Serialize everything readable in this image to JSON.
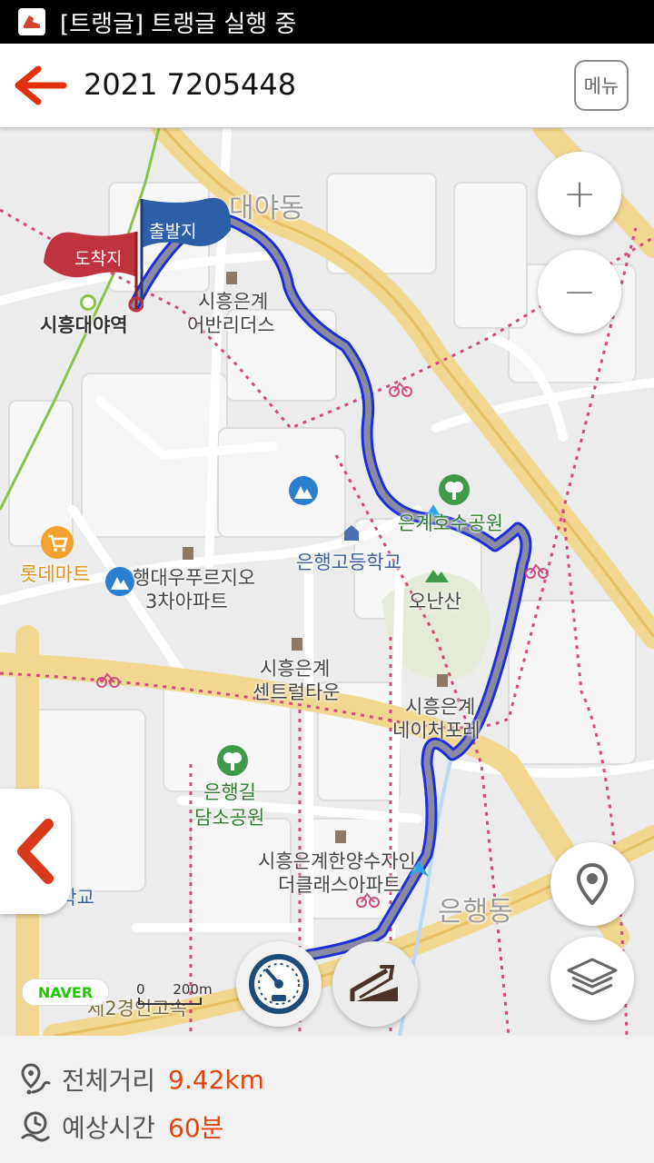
{
  "status_bar": {
    "app_icon": "trangle-shoe-icon",
    "text": "[트랭글] 트랭글 실행 중"
  },
  "header": {
    "title": "2021 7205448",
    "back_icon": "arrow-left-icon",
    "menu_label": "메뉴"
  },
  "map": {
    "flags": {
      "start": "출발지",
      "end": "도착지"
    },
    "labels": {
      "daeya_dong": "대야동",
      "station": "시흥대야역",
      "eunsan_1": "시흥은계",
      "eunsan_2": "어반리더스",
      "lake_park": "은계호수공원",
      "high_school": "은행고등학교",
      "lotte_mart": "롯데마트",
      "apt_1": "행대우푸르지오",
      "apt_2": "3차아파트",
      "onansan": "오난산",
      "central_1": "시흥은계",
      "central_2": "센트럴타운",
      "naepo_1": "시흥은계",
      "naepo_2": "네이처포레",
      "damso_1": "은행길",
      "damso_2": "담소공원",
      "hanyang_1": "시흥은계한양수자인",
      "hanyang_2": "더클래스아파트",
      "school_partial": "등학교",
      "eunhaeng_dong": "은행동",
      "highway": "제2경인고속"
    },
    "zoom_in": "+",
    "zoom_out": "−",
    "naver_logo": "NAVER",
    "scale_zero": "0",
    "scale_label": "200m"
  },
  "controls": {
    "speed_icon": "speedometer-icon",
    "elevation_icon": "elevation-icon",
    "location_icon": "location-pin-icon",
    "layers_icon": "layers-icon",
    "side_tab_icon": "chevron-left-icon"
  },
  "summary": {
    "distance_label": "전체거리",
    "distance_value": "9.42km",
    "time_label": "예상시간",
    "time_value": "60분"
  },
  "colors": {
    "accent": "#e0460f",
    "route": "#1f2fd8",
    "route_fill": "#8a8aa0",
    "start_flag": "#2d5fa8",
    "end_flag": "#c0323c"
  }
}
